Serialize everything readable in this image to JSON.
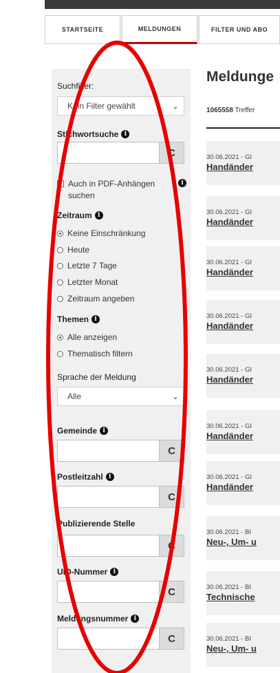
{
  "tabs": [
    {
      "label": "STARTSEITE"
    },
    {
      "label": "MELDUNGEN"
    },
    {
      "label": "FILTER UND ABO"
    }
  ],
  "sidebar": {
    "search_filter_label": "Suchfilter:",
    "filter_select_value": "Kein Filter gewählt",
    "keyword_label": "Stichwortsuche",
    "keyword_value": "",
    "pdf_checkbox_label_line1": "Auch in PDF-Anhängen",
    "pdf_checkbox_label_line2": "suchen",
    "pdf_checkbox_checked": false,
    "zeitraum_label": "Zeitraum",
    "zeitraum_options": [
      "Keine Einschränkung",
      "Heute",
      "Letzte 7 Tage",
      "Letzter Monat",
      "Zeitraum angeben"
    ],
    "zeitraum_selected": "Keine Einschränkung",
    "themen_label": "Themen",
    "themen_options": [
      "Alle anzeigen",
      "Thematisch filtern"
    ],
    "themen_selected": "Alle anzeigen",
    "language_label": "Sprache der Meldung",
    "language_value": "Alle",
    "gemeinde_label": "Gemeinde",
    "plz_label": "Postleitzahl",
    "publisher_label": "Publizierende Stelle",
    "uid_label": "UID-Nummer",
    "msgnr_label": "Meldungsnummer",
    "reset_glyph": "C"
  },
  "main": {
    "title": "Meldunge",
    "hits_count": "1065558",
    "hits_label": "Treffer",
    "results": [
      {
        "date": "30.06.2021 - GI",
        "title": "Handänder"
      },
      {
        "date": "30.06.2021 - GI",
        "title": "Handänder"
      },
      {
        "date": "30.06.2021 - GI",
        "title": "Handänder"
      },
      {
        "date": "30.06.2021 - GI",
        "title": "Handänder"
      },
      {
        "date": "30.06.2021 - GI",
        "title": "Handänder"
      },
      {
        "date": "30.06.2021 - GI",
        "title": "Handänder"
      },
      {
        "date": "30.06.2021 - GI",
        "title": "Handänder"
      },
      {
        "date": "30.06.2021 - BI",
        "title": "Neu-, Um- u"
      },
      {
        "date": "30.06.2021 - BI",
        "title": "Technische"
      },
      {
        "date": "30.06.2021 - BI",
        "title": "Neu-, Um- u"
      }
    ]
  },
  "colors": {
    "annotation_ellipse": "#e60000",
    "sidebar_bg": "#f0f0f0",
    "topbar": "#3a3a3a"
  }
}
